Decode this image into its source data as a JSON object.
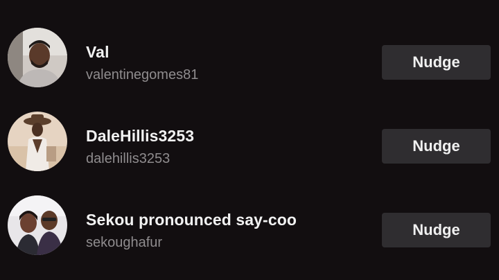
{
  "users": [
    {
      "display_name": "Val",
      "username": "valentinegomes81",
      "button_label": "Nudge"
    },
    {
      "display_name": "DaleHillis3253",
      "username": "dalehillis3253",
      "button_label": "Nudge"
    },
    {
      "display_name": "Sekou pronounced say-coo",
      "username": "sekoughafur",
      "button_label": "Nudge"
    }
  ],
  "colors": {
    "background": "#120e10",
    "button": "#2f2d30",
    "name_text": "#f2f2f2",
    "handle_text": "#8f8c8e"
  }
}
